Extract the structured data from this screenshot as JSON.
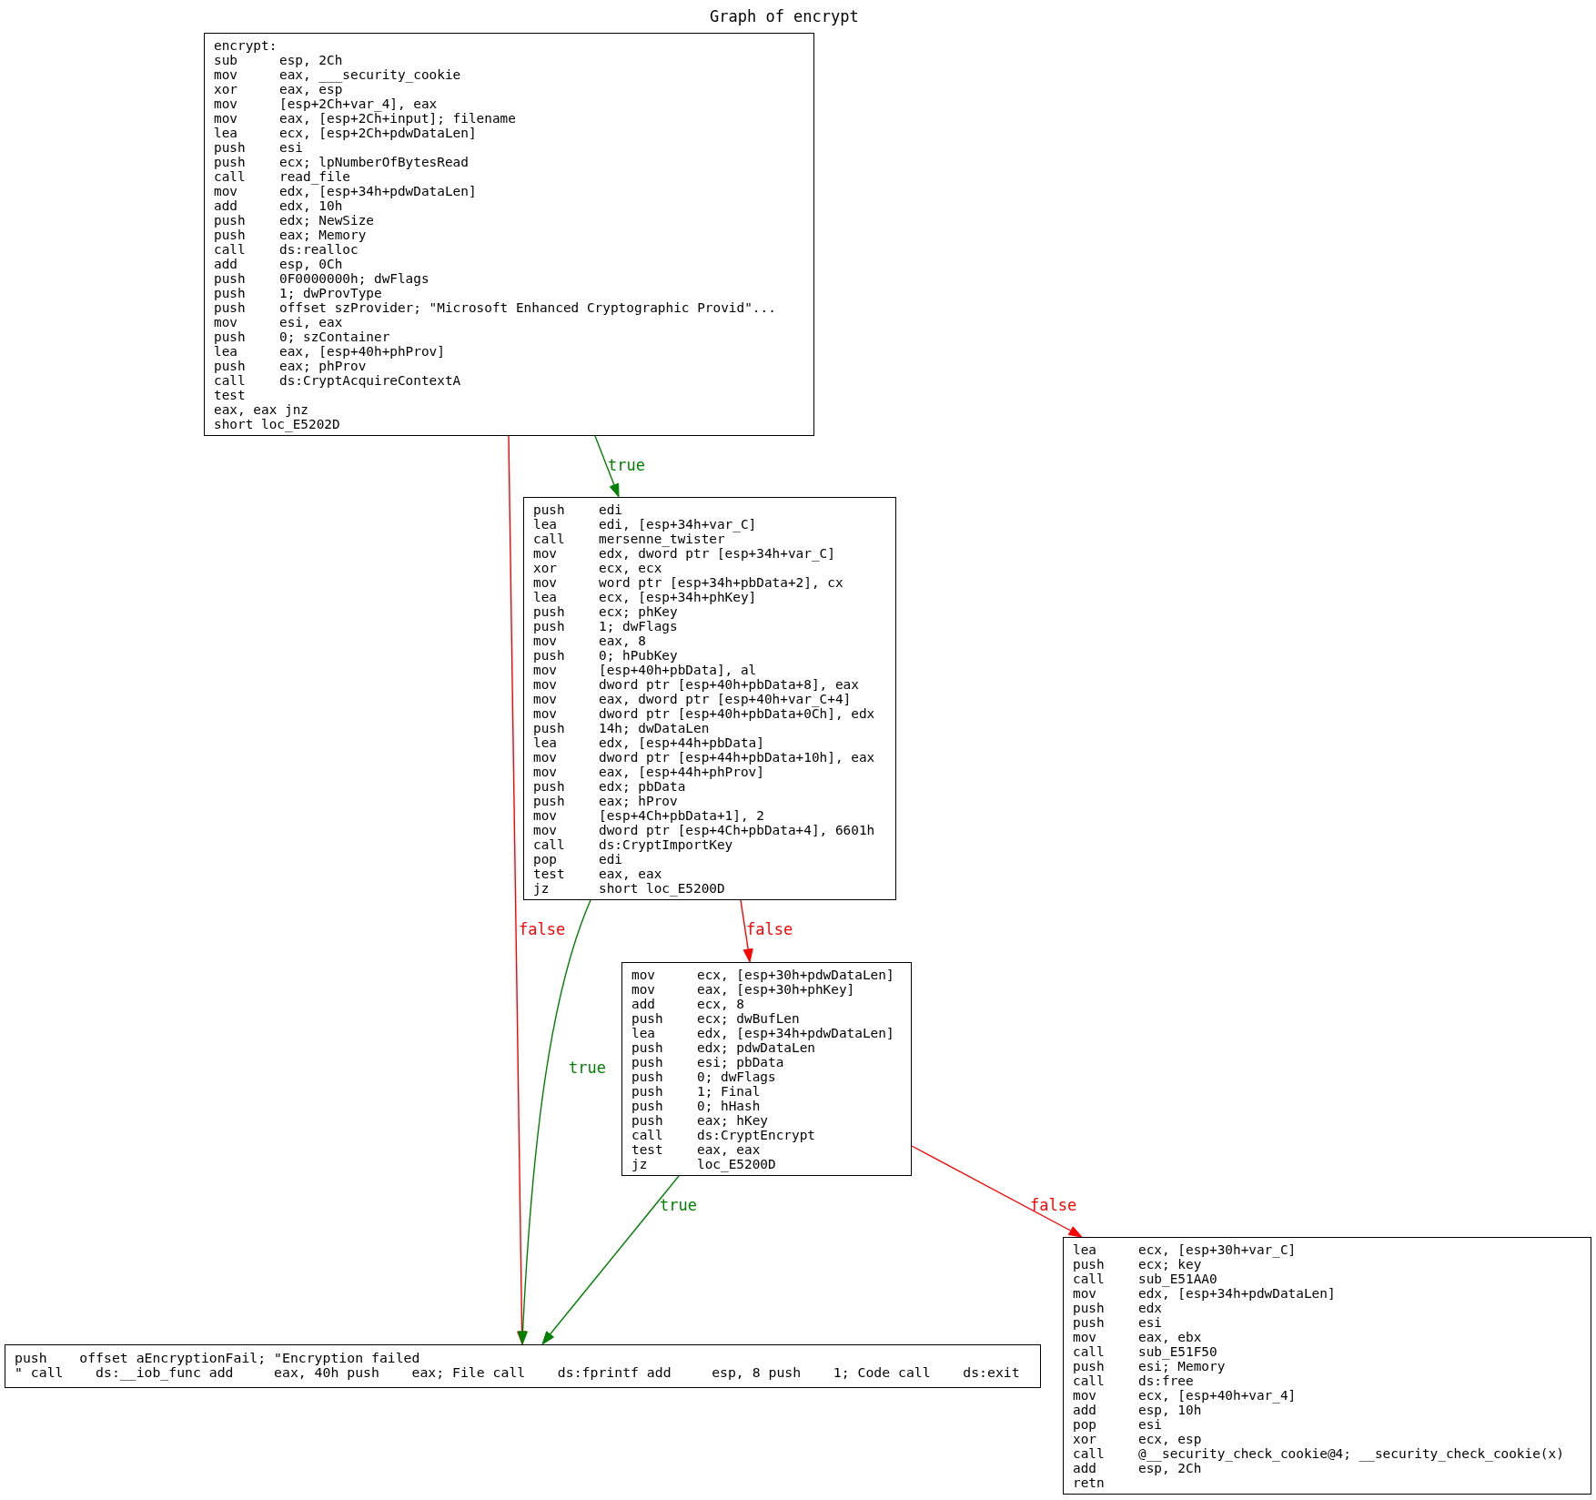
{
  "title": "Graph of encrypt",
  "nodes": [
    {
      "lines": [
        {
          "text": "encrypt:"
        },
        {
          "mnemonic": "sub",
          "operand": "esp, 2Ch"
        },
        {
          "mnemonic": "mov",
          "operand": "eax, ___security_cookie"
        },
        {
          "mnemonic": "xor",
          "operand": "eax, esp"
        },
        {
          "mnemonic": "mov",
          "operand": "[esp+2Ch+var_4], eax"
        },
        {
          "mnemonic": "mov",
          "operand": "eax, [esp+2Ch+input]; filename"
        },
        {
          "mnemonic": "lea",
          "operand": "ecx, [esp+2Ch+pdwDataLen]"
        },
        {
          "mnemonic": "push",
          "operand": "esi"
        },
        {
          "mnemonic": "push",
          "operand": "ecx; lpNumberOfBytesRead"
        },
        {
          "mnemonic": "call",
          "operand": "read_file"
        },
        {
          "mnemonic": "mov",
          "operand": "edx, [esp+34h+pdwDataLen]"
        },
        {
          "mnemonic": "add",
          "operand": "edx, 10h"
        },
        {
          "mnemonic": "push",
          "operand": "edx; NewSize"
        },
        {
          "mnemonic": "push",
          "operand": "eax; Memory"
        },
        {
          "mnemonic": "call",
          "operand": "ds:realloc"
        },
        {
          "mnemonic": "add",
          "operand": "esp, 0Ch"
        },
        {
          "mnemonic": "push",
          "operand": "0F0000000h; dwFlags"
        },
        {
          "mnemonic": "push",
          "operand": "1; dwProvType"
        },
        {
          "mnemonic": "push",
          "operand": "offset szProvider; \"Microsoft Enhanced Cryptographic Provid\"..."
        },
        {
          "mnemonic": "mov",
          "operand": "esi, eax"
        },
        {
          "mnemonic": "push",
          "operand": "0; szContainer"
        },
        {
          "mnemonic": "lea",
          "operand": "eax, [esp+40h+phProv]"
        },
        {
          "mnemonic": "push",
          "operand": "eax; phProv"
        },
        {
          "mnemonic": "call",
          "operand": "ds:CryptAcquireContextA"
        },
        {
          "text": "test"
        },
        {
          "text": "eax, eax jnz"
        },
        {
          "text": "short loc_E5202D"
        }
      ]
    },
    {
      "lines": [
        {
          "mnemonic": "push",
          "operand": "edi"
        },
        {
          "mnemonic": "lea",
          "operand": "edi, [esp+34h+var_C]"
        },
        {
          "mnemonic": "call",
          "operand": "mersenne_twister"
        },
        {
          "mnemonic": "mov",
          "operand": "edx, dword ptr [esp+34h+var_C]"
        },
        {
          "mnemonic": "xor",
          "operand": "ecx, ecx"
        },
        {
          "mnemonic": "mov",
          "operand": "word ptr [esp+34h+pbData+2], cx"
        },
        {
          "mnemonic": "lea",
          "operand": "ecx, [esp+34h+phKey]"
        },
        {
          "mnemonic": "push",
          "operand": "ecx; phKey"
        },
        {
          "mnemonic": "push",
          "operand": "1; dwFlags"
        },
        {
          "mnemonic": "mov",
          "operand": "eax, 8"
        },
        {
          "mnemonic": "push",
          "operand": "0; hPubKey"
        },
        {
          "mnemonic": "mov",
          "operand": "[esp+40h+pbData], al"
        },
        {
          "mnemonic": "mov",
          "operand": "dword ptr [esp+40h+pbData+8], eax"
        },
        {
          "mnemonic": "mov",
          "operand": "eax, dword ptr [esp+40h+var_C+4]"
        },
        {
          "mnemonic": "mov",
          "operand": "dword ptr [esp+40h+pbData+0Ch], edx"
        },
        {
          "mnemonic": "push",
          "operand": "14h; dwDataLen"
        },
        {
          "mnemonic": "lea",
          "operand": "edx, [esp+44h+pbData]"
        },
        {
          "mnemonic": "mov",
          "operand": "dword ptr [esp+44h+pbData+10h], eax"
        },
        {
          "mnemonic": "mov",
          "operand": "eax, [esp+44h+phProv]"
        },
        {
          "mnemonic": "push",
          "operand": "edx; pbData"
        },
        {
          "mnemonic": "push",
          "operand": "eax; hProv"
        },
        {
          "mnemonic": "mov",
          "operand": "[esp+4Ch+pbData+1], 2"
        },
        {
          "mnemonic": "mov",
          "operand": "dword ptr [esp+4Ch+pbData+4], 6601h"
        },
        {
          "mnemonic": "call",
          "operand": "ds:CryptImportKey"
        },
        {
          "mnemonic": "pop",
          "operand": "edi"
        },
        {
          "mnemonic": "test",
          "operand": "eax, eax"
        },
        {
          "mnemonic": "jz",
          "operand": "short loc_E5200D"
        }
      ]
    },
    {
      "lines": [
        {
          "mnemonic": "mov",
          "operand": "ecx, [esp+30h+pdwDataLen]"
        },
        {
          "mnemonic": "mov",
          "operand": "eax, [esp+30h+phKey]"
        },
        {
          "mnemonic": "add",
          "operand": "ecx, 8"
        },
        {
          "mnemonic": "push",
          "operand": "ecx; dwBufLen"
        },
        {
          "mnemonic": "lea",
          "operand": "edx, [esp+34h+pdwDataLen]"
        },
        {
          "mnemonic": "push",
          "operand": "edx; pdwDataLen"
        },
        {
          "mnemonic": "push",
          "operand": "esi; pbData"
        },
        {
          "mnemonic": "push",
          "operand": "0; dwFlags"
        },
        {
          "mnemonic": "push",
          "operand": "1; Final"
        },
        {
          "mnemonic": "push",
          "operand": "0; hHash"
        },
        {
          "mnemonic": "push",
          "operand": "eax; hKey"
        },
        {
          "mnemonic": "call",
          "operand": "ds:CryptEncrypt"
        },
        {
          "mnemonic": "test",
          "operand": "eax, eax"
        },
        {
          "mnemonic": "jz",
          "operand": "loc_E5200D"
        }
      ]
    },
    {
      "lines": [
        {
          "text": "push    offset aEncryptionFail; \"Encryption failed"
        },
        {
          "text": "\" call    ds:__iob_func add     eax, 40h push    eax; File call    ds:fprintf add     esp, 8 push    1; Code call    ds:exit"
        }
      ]
    },
    {
      "lines": [
        {
          "mnemonic": "lea",
          "operand": "ecx, [esp+30h+var_C]"
        },
        {
          "mnemonic": "push",
          "operand": "ecx; key"
        },
        {
          "mnemonic": "call",
          "operand": "sub_E51AA0"
        },
        {
          "mnemonic": "mov",
          "operand": "edx, [esp+34h+pdwDataLen]"
        },
        {
          "mnemonic": "push",
          "operand": "edx"
        },
        {
          "mnemonic": "push",
          "operand": "esi"
        },
        {
          "mnemonic": "mov",
          "operand": "eax, ebx"
        },
        {
          "mnemonic": "call",
          "operand": "sub_E51F50"
        },
        {
          "mnemonic": "push",
          "operand": "esi; Memory"
        },
        {
          "mnemonic": "call",
          "operand": "ds:free"
        },
        {
          "mnemonic": "mov",
          "operand": "ecx, [esp+40h+var_4]"
        },
        {
          "mnemonic": "add",
          "operand": "esp, 10h"
        },
        {
          "mnemonic": "pop",
          "operand": "esi"
        },
        {
          "mnemonic": "xor",
          "operand": "ecx, esp"
        },
        {
          "mnemonic": "call",
          "operand": "@__security_check_cookie@4; __security_check_cookie(x)"
        },
        {
          "mnemonic": "add",
          "operand": "esp, 2Ch"
        },
        {
          "mnemonic": "retn"
        }
      ]
    }
  ],
  "edges": [
    {
      "kind": "false",
      "label": "false"
    },
    {
      "kind": "true",
      "label": "true"
    },
    {
      "kind": "true",
      "label": "true"
    },
    {
      "kind": "false",
      "label": "false"
    },
    {
      "kind": "true",
      "label": "true"
    },
    {
      "kind": "false",
      "label": "false"
    }
  ]
}
